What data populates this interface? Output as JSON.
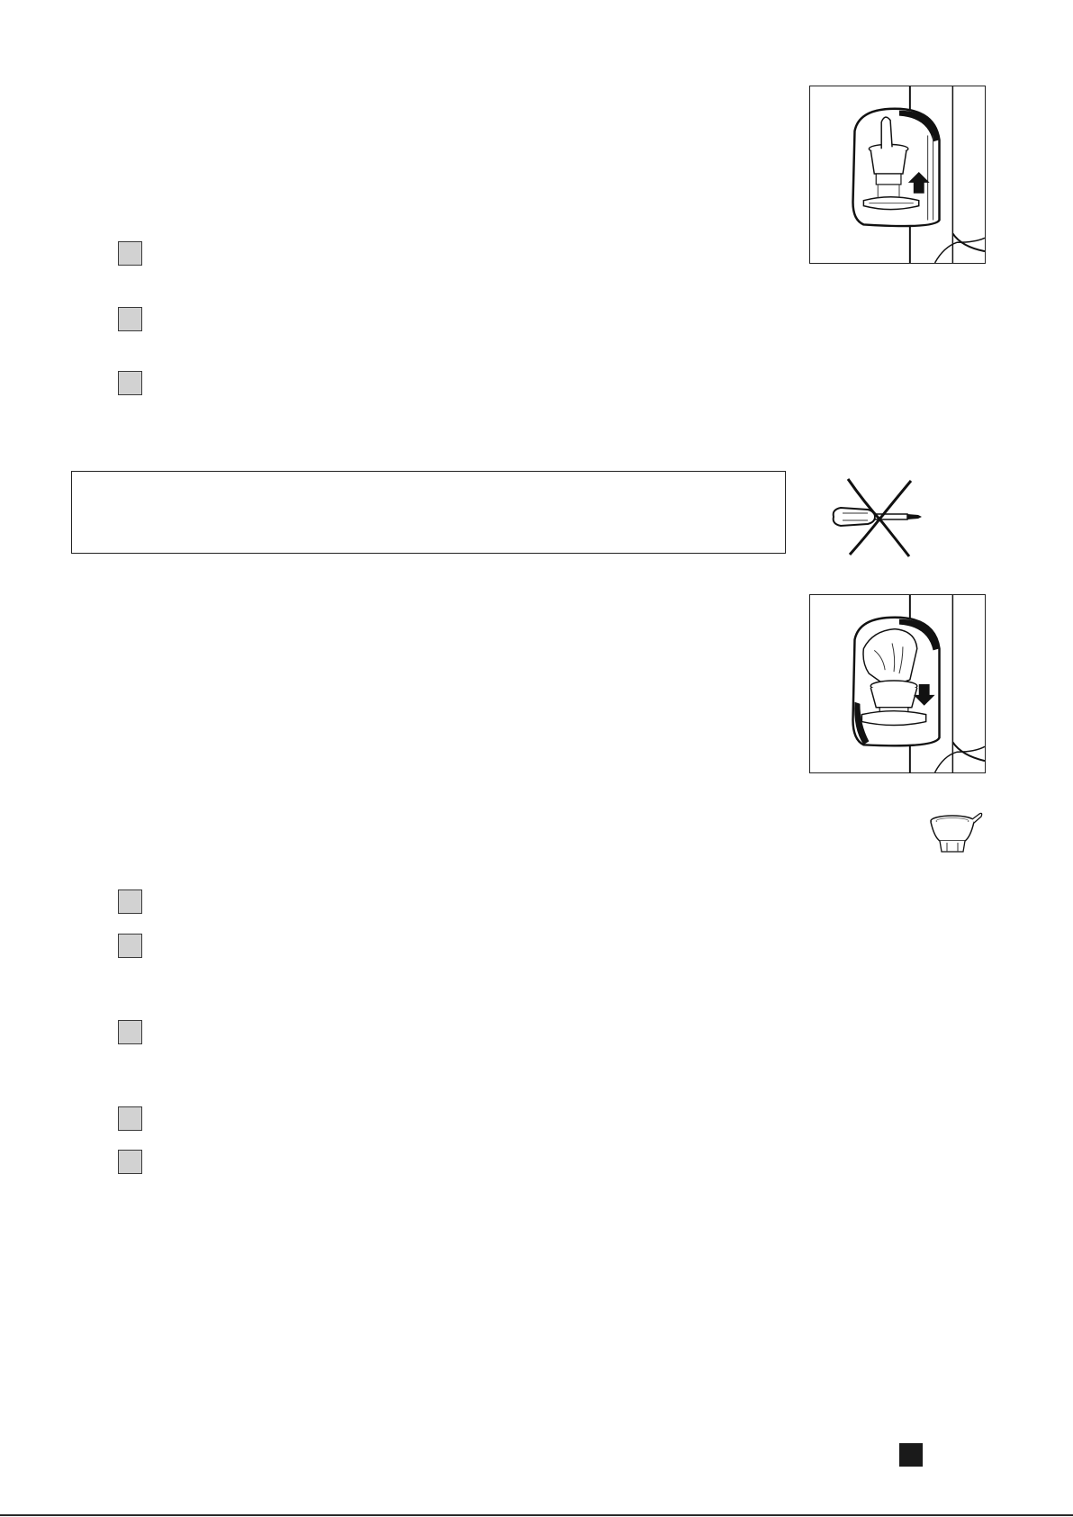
{
  "page": {
    "background": "#ffffff"
  },
  "figures": {
    "fig_pod_insert": {
      "icon": "pod-lift-up-illustration",
      "arrow": "up"
    },
    "fig_no_screwdriver": {
      "icon": "no-screwdriver-icon"
    },
    "fig_pod_remove": {
      "icon": "pod-push-down-illustration",
      "arrow": "down"
    },
    "fig_pod_small": {
      "icon": "coffee-pod-icon"
    }
  },
  "step_markers": {
    "group_1_count": 3,
    "group_2_count": 5,
    "fill_color": "#d2d2d2",
    "border_color": "#3a3a3a"
  },
  "warning_box": {
    "border_color": "#222222"
  },
  "page_marker": {
    "color": "#1a1a1a"
  }
}
